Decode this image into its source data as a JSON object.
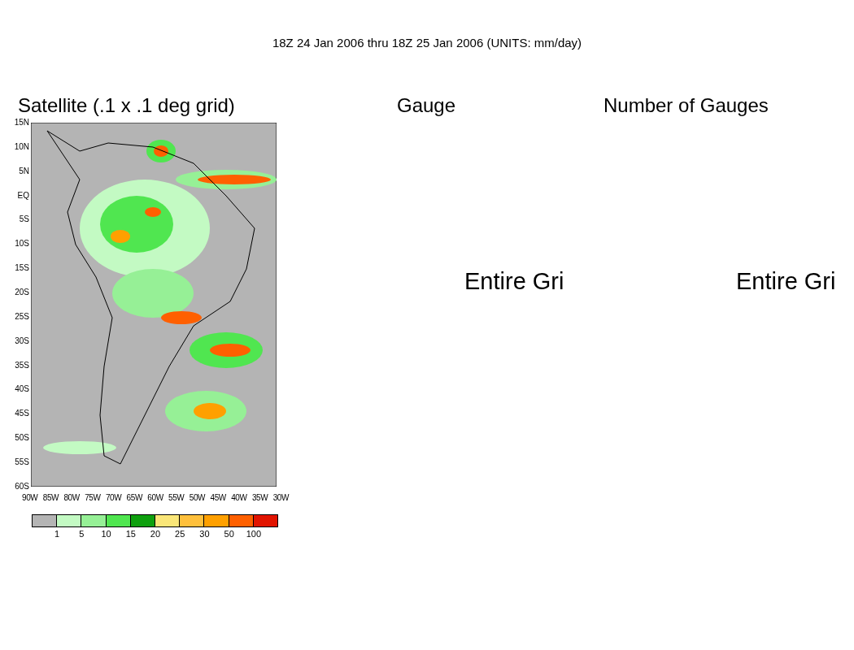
{
  "title": "18Z 24 Jan 2006 thru 18Z 25 Jan 2006 (UNITS: mm/day)",
  "panels": [
    {
      "kind": "map",
      "heading": "Satellite (.1 x .1 deg grid)",
      "yticks": [
        "15N",
        "10N",
        "5N",
        "EQ",
        "5S",
        "10S",
        "15S",
        "20S",
        "25S",
        "30S",
        "35S",
        "40S",
        "45S",
        "50S",
        "55S",
        "60S"
      ],
      "xticks": [
        "90W",
        "85W",
        "80W",
        "75W",
        "70W",
        "65W",
        "60W",
        "55W",
        "50W",
        "45W",
        "40W",
        "35W",
        "30W"
      ],
      "colorbar": {
        "colors": [
          {
            "color": "#b4b4b4"
          },
          {
            "color": "#c3fac3"
          },
          {
            "color": "#96f096"
          },
          {
            "color": "#50e650"
          },
          {
            "color": "#0fa00f"
          },
          {
            "color": "#fae678"
          },
          {
            "color": "#ffc03c"
          },
          {
            "color": "#ffa000"
          },
          {
            "color": "#ff6000"
          },
          {
            "color": "#e11400"
          }
        ],
        "labels": [
          "1",
          "5",
          "10",
          "15",
          "20",
          "25",
          "30",
          "50",
          "100"
        ]
      }
    },
    {
      "kind": "message",
      "heading": "Gauge",
      "message": "Entire Gri"
    },
    {
      "kind": "message",
      "heading": "Number of Gauges",
      "message": "Entire Gri"
    }
  ]
}
